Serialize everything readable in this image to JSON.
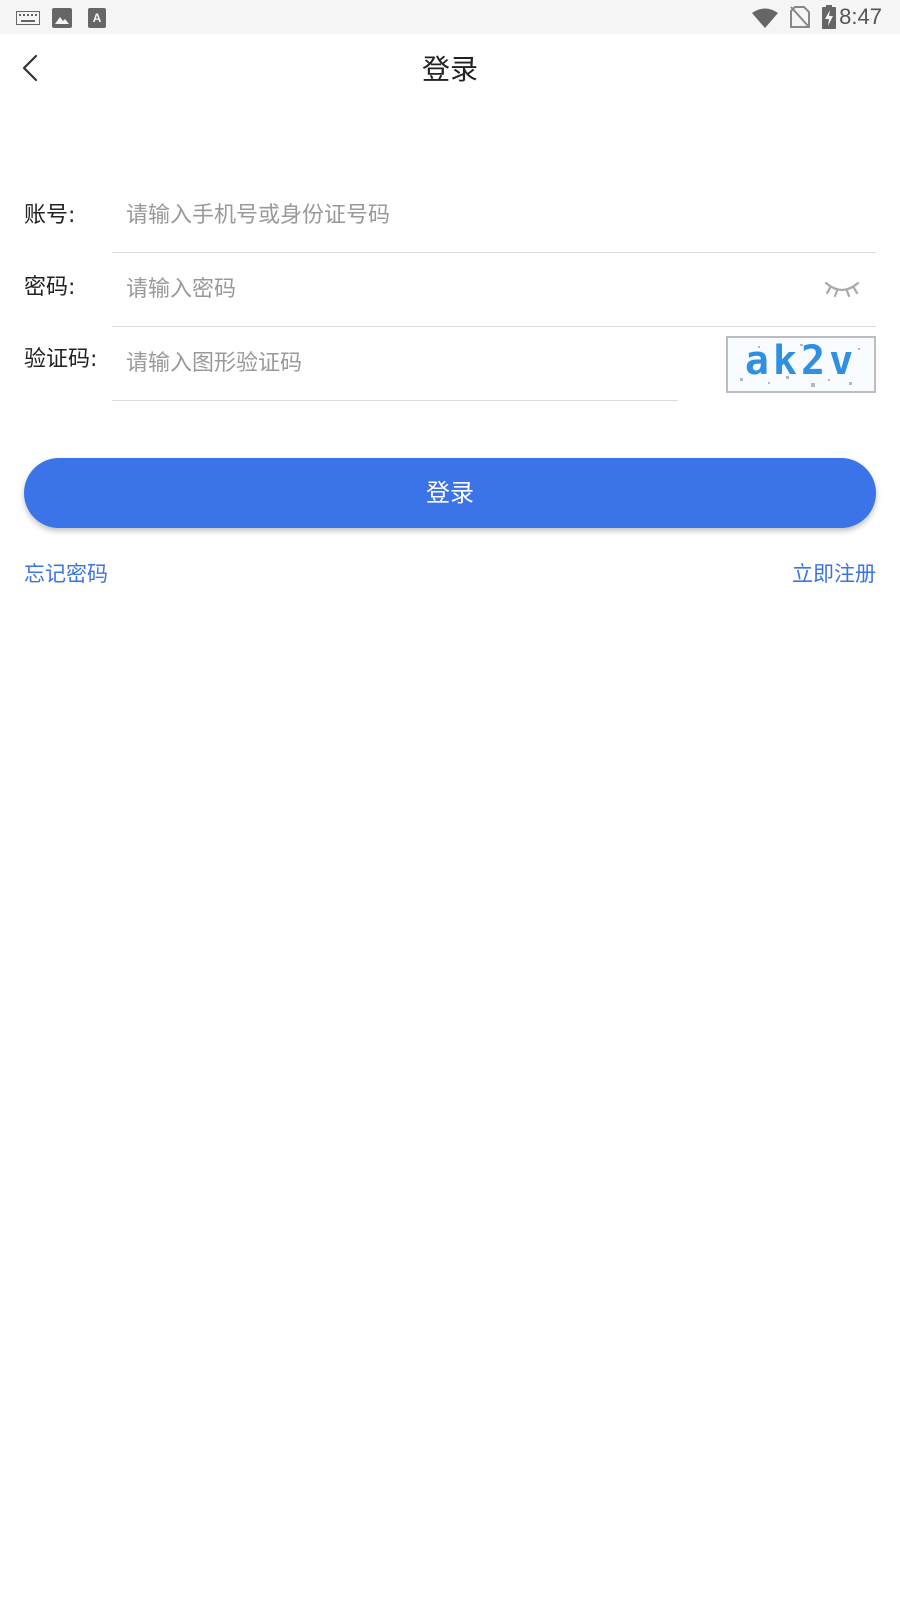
{
  "status_bar": {
    "time": "8:47",
    "icons": [
      "keyboard-icon",
      "image-icon",
      "text-a-icon",
      "wifi-icon",
      "no-sim-icon",
      "battery-charging-icon"
    ]
  },
  "header": {
    "title": "登录",
    "back_icon": "chevron-left-icon"
  },
  "form": {
    "account": {
      "label": "账号:",
      "placeholder": "请输入手机号或身份证号码",
      "value": ""
    },
    "password": {
      "label": "密码:",
      "placeholder": "请输入密码",
      "value": "",
      "toggle_icon": "eye-closed-icon"
    },
    "captcha": {
      "label": "验证码:",
      "placeholder": "请输入图形验证码",
      "value": "",
      "image_text": "ak2v"
    }
  },
  "actions": {
    "login_label": "登录",
    "forgot_password": "忘记密码",
    "register": "立即注册"
  },
  "colors": {
    "primary": "#3b73e8",
    "status_bar_bg": "#f5f5f5",
    "divider": "#dcdcdc"
  }
}
